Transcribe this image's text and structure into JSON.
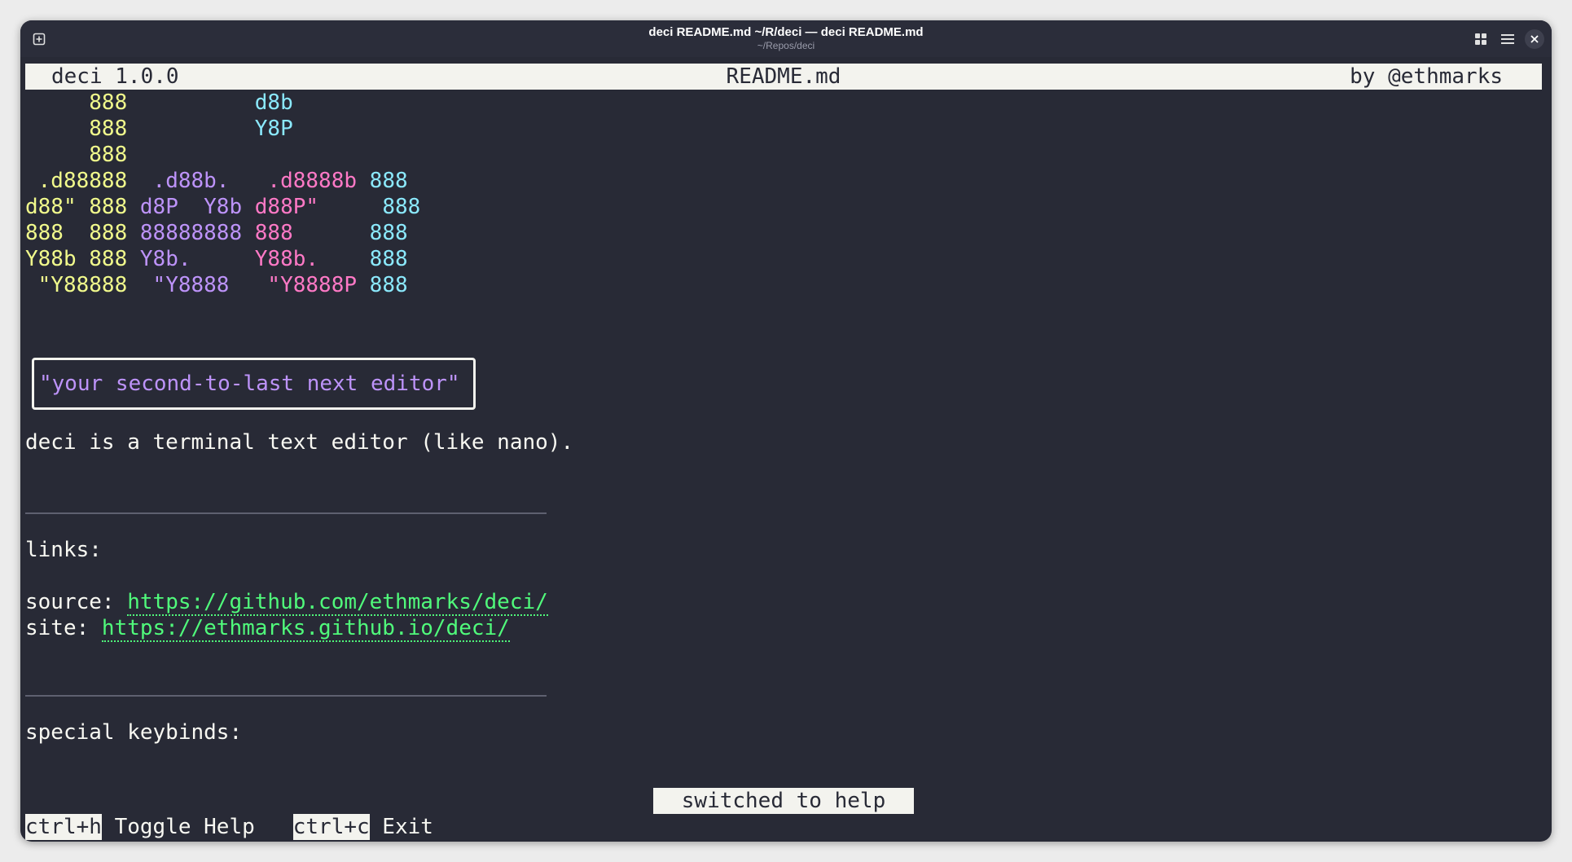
{
  "window": {
    "title": "deci README.md ~/R/deci — deci README.md",
    "subtitle": "~/Repos/deci",
    "new_tab_icon": "new-tab-icon",
    "grid_icon": "grid-icon",
    "menu_icon": "hamburger-menu-icon",
    "close_icon": "close-icon"
  },
  "header": {
    "app_version": "deci 1.0.0",
    "filename": "README.md",
    "author": "by @ethmarks"
  },
  "logo_lines": [
    {
      "y": "     888",
      "p": "",
      "k": "",
      "c": "          d8b"
    },
    {
      "y": "     888",
      "p": "",
      "k": "",
      "c": "          Y8P"
    },
    {
      "y": "     888",
      "p": "",
      "k": "",
      "c": ""
    },
    {
      "y": " .d88888",
      "p": "  .d88b.",
      "k": "   .d8888b",
      "c": " 888"
    },
    {
      "y": "d88\" 888",
      "p": " d8P  Y8b",
      "k": " d88P\"",
      "c": "     888"
    },
    {
      "y": "888  888",
      "p": " 88888888",
      "k": " 888",
      "c": "      888"
    },
    {
      "y": "Y88b 888",
      "p": " Y8b.",
      "k": "     Y88b.",
      "c": "    888"
    },
    {
      "y": " \"Y88888",
      "p": "  \"Y8888",
      "k": "   \"Y8888P",
      "c": " 888"
    }
  ],
  "tagline": "\"your second-to-last next editor\"",
  "description": "deci is a terminal text editor (like nano).",
  "links_heading": "links:",
  "source_label": "source: ",
  "source_url": "https://github.com/ethmarks/deci/",
  "site_label": "site: ",
  "site_url": "https://ethmarks.github.io/deci/",
  "keybinds_heading": "special keybinds:",
  "status_message": "switched to help",
  "footer": {
    "key1": "ctrl+h",
    "action1": " Toggle Help",
    "key2": "ctrl+c",
    "action2": " Exit"
  },
  "colors": {
    "background": "#282a36",
    "yellow": "#f1fa8c",
    "purple": "#bd93f9",
    "pink": "#ff79c6",
    "cyan": "#8be9fd",
    "green": "#50fa7b"
  }
}
